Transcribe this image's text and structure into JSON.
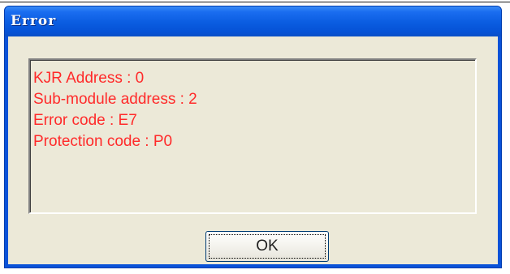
{
  "window": {
    "title": "Error"
  },
  "message": {
    "lines": [
      "KJR Address : 0",
      "Sub-module address : 2",
      "Error code : E7",
      "Protection code : P0"
    ]
  },
  "buttons": {
    "ok_label": "OK"
  },
  "colors": {
    "title_bar": "#0a5ce0",
    "dialog_face": "#ece9d8",
    "message_text": "#ff2a2a"
  }
}
